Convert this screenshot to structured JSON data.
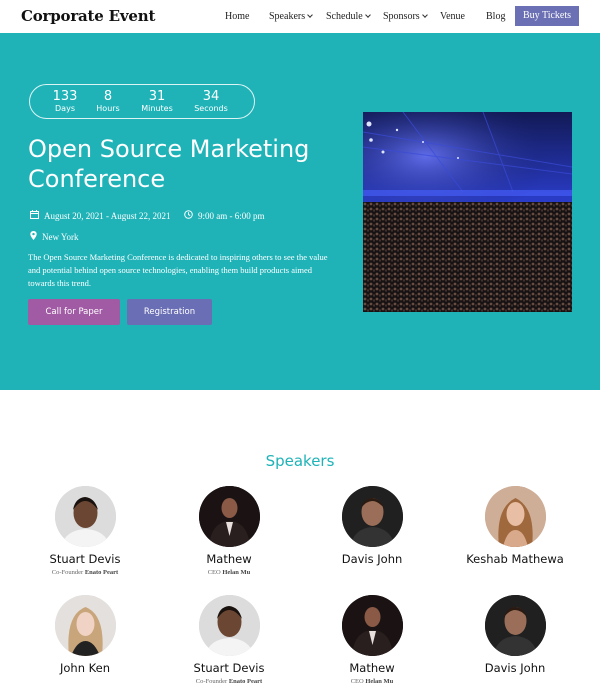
{
  "header": {
    "brand": "Corporate Event",
    "nav": [
      {
        "label": "Home",
        "dropdown": false
      },
      {
        "label": "Speakers",
        "dropdown": true
      },
      {
        "label": "Schedule",
        "dropdown": true
      },
      {
        "label": "Sponsors",
        "dropdown": true
      },
      {
        "label": "Venue",
        "dropdown": false
      },
      {
        "label": "Blog",
        "dropdown": false
      }
    ],
    "cta": "Buy Tickets"
  },
  "hero": {
    "countdown": [
      {
        "value": "133",
        "label": "Days"
      },
      {
        "value": "8",
        "label": "Hours"
      },
      {
        "value": "31",
        "label": "Minutes"
      },
      {
        "value": "34",
        "label": "Seconds"
      }
    ],
    "title": "Open Source Marketing Conference",
    "date": "August 20, 2021 - August 22, 2021",
    "time": "9:00 am - 6:00 pm",
    "location": "New York",
    "description": "The Open Source Marketing Conference is dedicated to inspiring others to see the value and potential behind open source technologies, enabling them build products aimed towards this trend.",
    "buttons": {
      "paper": "Call for Paper",
      "registration": "Registration"
    }
  },
  "speakers": {
    "title": "Speakers",
    "items": [
      {
        "name": "Stuart Devis",
        "role_prefix": "Co-Founder",
        "company": "Enato Peart"
      },
      {
        "name": "Mathew",
        "role_prefix": "CEO",
        "company": "Helan Mu"
      },
      {
        "name": "Davis John",
        "role_prefix": "",
        "company": ""
      },
      {
        "name": "Keshab Mathewa",
        "role_prefix": "",
        "company": ""
      },
      {
        "name": "John Ken",
        "role_prefix": "",
        "company": ""
      },
      {
        "name": "Stuart Devis",
        "role_prefix": "Co-Founder",
        "company": "Enato Peart"
      },
      {
        "name": "Mathew",
        "role_prefix": "CEO",
        "company": "Helan Mu"
      },
      {
        "name": "Davis John",
        "role_prefix": "",
        "company": ""
      }
    ]
  },
  "colors": {
    "hero_bg": "#1fb3b8",
    "cta": "#6b6fb4",
    "paper_button": "#a15aa4",
    "registration_button": "#6a6eb4",
    "section_title": "#1fb3b8"
  }
}
